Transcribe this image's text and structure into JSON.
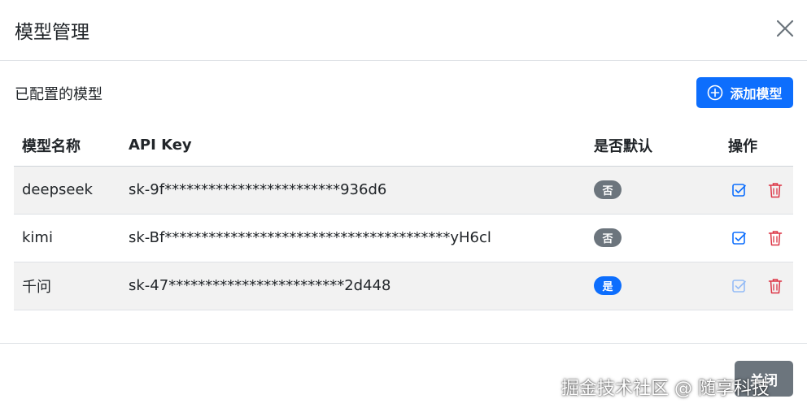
{
  "modal": {
    "title": "模型管理",
    "close_icon": "close-icon"
  },
  "section": {
    "label": "已配置的模型",
    "add_button": {
      "icon": "plus-circle-icon",
      "label": "添加模型"
    }
  },
  "table": {
    "headers": {
      "name": "模型名称",
      "key": "API Key",
      "default": "是否默认",
      "ops": "操作"
    },
    "rows": [
      {
        "name": "deepseek",
        "key": "sk-9f************************936d6",
        "default": "否",
        "is_default": false,
        "edit_icon": "edit-check-icon",
        "delete_icon": "trash-icon"
      },
      {
        "name": "kimi",
        "key": "sk-Bf***************************************yH6cl",
        "default": "否",
        "is_default": false,
        "edit_icon": "edit-check-icon",
        "delete_icon": "trash-icon"
      },
      {
        "name": "千问",
        "key": "sk-47************************2d448",
        "default": "是",
        "is_default": true,
        "edit_icon": "edit-check-icon",
        "delete_icon": "trash-icon"
      }
    ]
  },
  "footer": {
    "close_button": "关闭",
    "watermark": "掘金技术社区 @ 随享科技"
  },
  "colors": {
    "primary": "#0d6efd",
    "secondary": "#6c757d",
    "danger": "#dc3545",
    "stripe": "#f2f2f2"
  }
}
